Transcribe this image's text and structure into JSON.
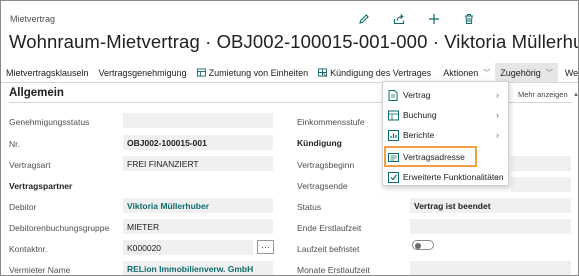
{
  "header": {
    "page_type": "Mietvertrag",
    "title": "Wohnraum-Mietvertrag · OBJ002-100015-001-000 · Viktoria Müllerhuber",
    "icons": [
      "edit-icon",
      "share-icon",
      "add-icon",
      "delete-icon"
    ]
  },
  "actionbar": {
    "items": [
      {
        "label": "Mietvertragsklauseln"
      },
      {
        "label": "Vertragsgenehmigung"
      },
      {
        "label": "Zumietung von Einheiten",
        "icon": "table-icon"
      },
      {
        "label": "Kündigung des Vertrages",
        "icon": "grid-icon"
      },
      {
        "label": "Aktionen"
      },
      {
        "label": "Zugehörig"
      },
      {
        "label": "Weniger Optionen"
      }
    ]
  },
  "section": {
    "title": "Allgemein",
    "show_more": "Mehr anzeigen"
  },
  "left_fields": {
    "genehmigungsstatus": {
      "label": "Genehmigungsstatus",
      "value": ""
    },
    "nr": {
      "label": "Nr.",
      "value": "OBJ002-100015-001"
    },
    "vertragsart": {
      "label": "Vertragsart",
      "value": "FREI FINANZIERT"
    },
    "vertragspartner_head": "Vertragspartner",
    "debitor": {
      "label": "Debitor",
      "value": "Viktoria Müllerhuber"
    },
    "debitorenbuchungsgruppe": {
      "label": "Debitorenbuchungsgruppe",
      "value": "MIETER"
    },
    "kontaktnr": {
      "label": "Kontaktnr.",
      "value": "K000020",
      "button": "···"
    },
    "vermieter": {
      "label": "Vermieter Name",
      "value": "RELion Immobilienverw. GmbH"
    }
  },
  "right_fields": {
    "einkommensstufe": {
      "label": "Einkommensstufe"
    },
    "kuendigung_head": "Kündigung",
    "vertragsbeginn": {
      "label": "Vertragsbeginn"
    },
    "vertragsende": {
      "label": "Vertragsende"
    },
    "status": {
      "label": "Status",
      "value": "Vertrag ist beendet"
    },
    "ende_erstlaufzeit": {
      "label": "Ende Erstlaufzeit",
      "value": ""
    },
    "laufzeit_befristet": {
      "label": "Laufzeit befristet",
      "toggle": false
    },
    "monate_erstlaufzeit": {
      "label": "Monate Erstlaufzeit",
      "value": ""
    }
  },
  "dropdown": {
    "items": [
      {
        "label": "Vertrag",
        "icon": "document-icon",
        "has_submenu": true
      },
      {
        "label": "Buchung",
        "icon": "ledger-icon",
        "has_submenu": true
      },
      {
        "label": "Berichte",
        "icon": "report-icon",
        "has_submenu": true
      },
      {
        "label": "Vertragsadresse",
        "icon": "address-card-icon",
        "has_submenu": false,
        "highlighted": true
      },
      {
        "label": "Erweiterte Funktionalitäten",
        "icon": "extension-icon",
        "has_submenu": true
      }
    ]
  },
  "colors": {
    "accent_teal": "#0e6b6b",
    "highlight_orange": "#f0a046",
    "field_bg": "#f0f0f0"
  }
}
